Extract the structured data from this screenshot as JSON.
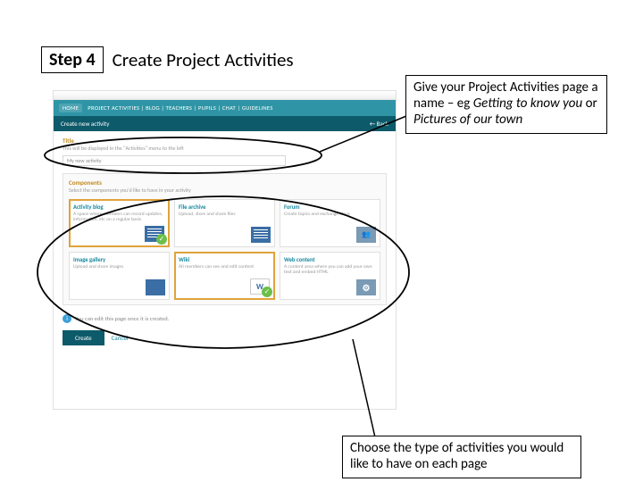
{
  "header": {
    "step_label": "Step 4",
    "title": "Create Project Activities"
  },
  "callout_top": {
    "prefix": "Give your Project Activities page a name – eg ",
    "italic1": "Getting to know you",
    "mid": " or ",
    "italic2": "Pictures of our town"
  },
  "callout_bottom": "Choose the type of activities you would like to have on each page",
  "screenshot": {
    "nav": {
      "home": "HOME",
      "items": "PROJECT ACTIVITIES  |  BLOG  |  TEACHERS  |  PUPILS  |  CHAT  |  GUIDELINES"
    },
    "bar": {
      "title": "Create new activity",
      "back": "← Back"
    },
    "title_block": {
      "label": "Title",
      "hint": "This will be displayed in the \"Activities\" menu to the left",
      "placeholder": "My new activity"
    },
    "components": {
      "label": "Components",
      "hint": "Select the components you'd like to have in your activity"
    },
    "cards": [
      {
        "t": "Activity blog",
        "d": "A space where members can record updates, information, etc on a regular basis",
        "icon": "lines",
        "sel": true
      },
      {
        "t": "File archive",
        "d": "Upload, store and share files",
        "icon": "lines",
        "sel": false
      },
      {
        "t": "Forum",
        "d": "Create topics and exchange ideas",
        "icon": "people",
        "sel": false
      },
      {
        "t": "Image gallery",
        "d": "Upload and share images",
        "icon": "grid4",
        "sel": false
      },
      {
        "t": "Wiki",
        "d": "All members can see and edit content",
        "icon": "W",
        "sel": true
      },
      {
        "t": "Web content",
        "d": "A content area where you can add your own text and embed HTML",
        "icon": "gears",
        "sel": false
      }
    ],
    "note": "You can edit this page once it is created.",
    "actions": {
      "create": "Create",
      "cancel": "Cancel"
    }
  }
}
